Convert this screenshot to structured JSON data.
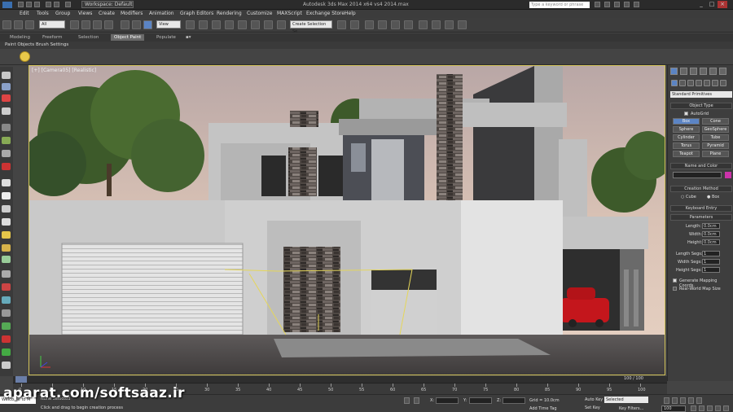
{
  "titlebar": {
    "workspace": "Workspace: Default",
    "title": "Autodesk 3ds Max 2014 x64    vs4 2014.max",
    "search_placeholder": "Type a keyword or phrase"
  },
  "menu": [
    "Edit",
    "Tools",
    "Group",
    "Views",
    "Create",
    "Modifiers",
    "Animation",
    "Graph Editors",
    "Rendering",
    "Customize",
    "MAXScript",
    "Exchange Store",
    "Help"
  ],
  "toolbar": {
    "filter": "All",
    "refcoord": "View",
    "named_selection": "Create Selection Se"
  },
  "ribbon": {
    "tabs": [
      "Modeling",
      "Freeform",
      "Selection",
      "Object Paint",
      "Populate"
    ],
    "active": "Object Paint",
    "subtabs": [
      "Paint Objects",
      "Brush Settings"
    ]
  },
  "viewport": {
    "label": "[+] [Camera05] [Realistic]"
  },
  "command_panel": {
    "category": "Standard Primitives",
    "object_type_title": "Object Type",
    "autogrid": "AutoGrid",
    "primitives": [
      "Box",
      "Cone",
      "Sphere",
      "GeoSphere",
      "Cylinder",
      "Tube",
      "Torus",
      "Pyramid",
      "Teapot",
      "Plane"
    ],
    "active_primitive": "Box",
    "name_color_title": "Name and Color",
    "creation_method_title": "Creation Method",
    "creation_options": [
      "Cube",
      "Box"
    ],
    "keyboard_entry": "Keyboard Entry",
    "parameters_title": "Parameters",
    "length_label": "Length:",
    "width_label": "Width:",
    "height_label": "Height:",
    "length_value": "0.0cm",
    "width_value": "0.0cm",
    "height_value": "0.0cm",
    "length_segs_label": "Length Segs:",
    "width_segs_label": "Width Segs:",
    "height_segs_label": "Height Segs:",
    "length_segs": "1",
    "width_segs": "1",
    "height_segs": "1",
    "gen_mapping": "Generate Mapping Coords.",
    "real_world": "Real-World Map Size"
  },
  "timeline": {
    "frames": "100 / 100",
    "ticks": [
      "0",
      "5",
      "10",
      "15",
      "20",
      "25",
      "30",
      "35",
      "40",
      "45",
      "50",
      "55",
      "60",
      "65",
      "70",
      "75",
      "80",
      "85",
      "90",
      "95",
      "100"
    ]
  },
  "statusbar": {
    "maxscript": "Welcome to M",
    "status": "None Selected",
    "prompt": "Click and drag to begin creation process",
    "x_label": "X:",
    "y_label": "Y:",
    "z_label": "Z:",
    "grid": "Grid = 10.0cm",
    "add_time_tag": "Add Time Tag",
    "auto_key": "Auto Key",
    "set_key": "Set Key",
    "selection_filter": "Selected",
    "key_filters": "Key Filters...",
    "frame": "100"
  },
  "watermark": "aparat.com/softsaaz.ir",
  "colors": {
    "active_blue": "#5b84c4",
    "viewport_border": "#d2c35a",
    "color_swatch": "#cc33aa"
  }
}
